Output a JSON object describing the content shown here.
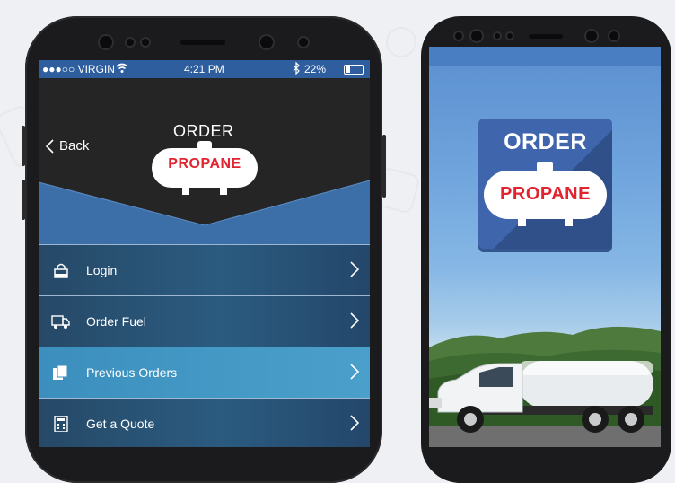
{
  "status_bar": {
    "carrier": "●●●○○ VIRGIN",
    "time": "4:21 PM",
    "battery": "22%"
  },
  "header": {
    "back_label": "Back",
    "order_label": "ORDER",
    "propane_label": "PROPANE"
  },
  "menu": {
    "items": [
      {
        "label": "Login",
        "icon": "lock-icon"
      },
      {
        "label": "Order Fuel",
        "icon": "truck-icon"
      },
      {
        "label": "Previous Orders",
        "icon": "documents-icon"
      },
      {
        "label": "Get a Quote",
        "icon": "calculator-icon"
      }
    ],
    "active_index": 2
  },
  "splash": {
    "order_label": "ORDER",
    "propane_label": "PROPANE"
  },
  "colors": {
    "status_bar": "#2f5e9f",
    "menu_active": "#4aa0cb",
    "propane_red": "#e1242f",
    "logo_tile": "#3f66ad"
  }
}
